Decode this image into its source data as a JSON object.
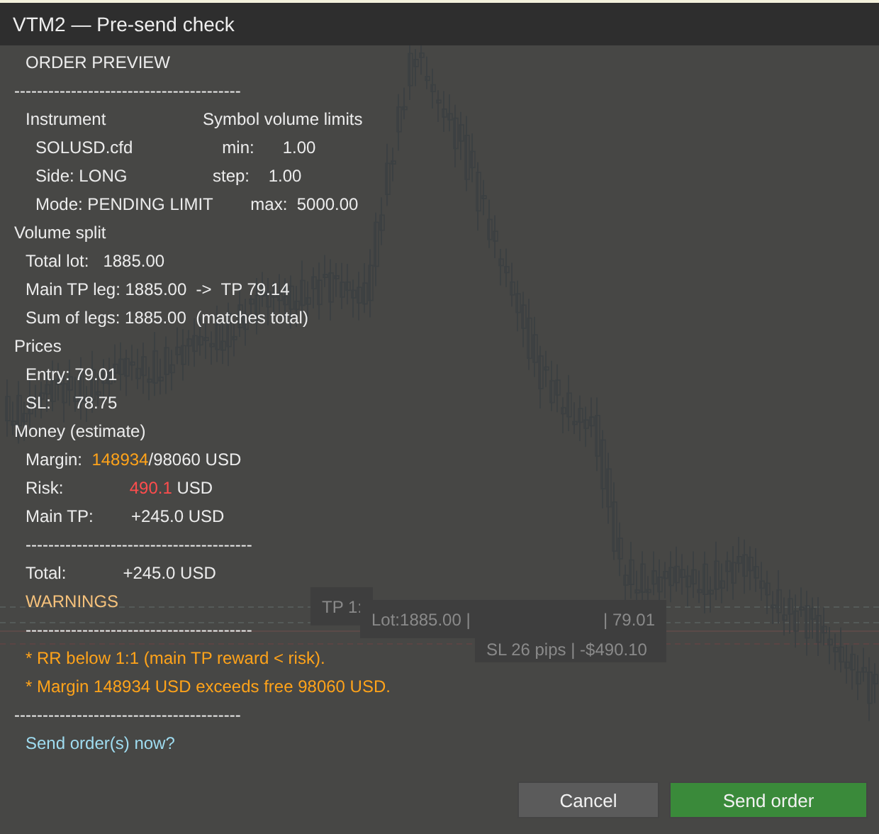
{
  "window": {
    "title": "VTM2 — Pre-send check"
  },
  "chart_tags": [
    {
      "texts": [
        "TP 1:"
      ]
    },
    {
      "texts": [
        "Lot:1885.00 |",
        "| 79.01"
      ]
    },
    {
      "texts": [
        "SL 26 pips | -$490.10"
      ]
    }
  ],
  "lines": [
    {
      "kind": "heading",
      "text": "ORDER PREVIEW"
    },
    {
      "kind": "rule",
      "text": "----------------------------------------"
    },
    {
      "kind": "pair-item",
      "left": "Instrument",
      "right": "Symbol volume limits"
    },
    {
      "kind": "pair-subitem",
      "left": "SOLUSD.cfd",
      "right": "  min:      1.00"
    },
    {
      "kind": "pair-subitem",
      "left": "Side: LONG",
      "right": "step:    1.00"
    },
    {
      "kind": "pair-subitem",
      "left": "Mode: PENDING LIMIT",
      "right": "        max:  5000.00"
    },
    {
      "kind": "section",
      "text": "Volume split"
    },
    {
      "kind": "item",
      "text": "Total lot:   1885.00"
    },
    {
      "kind": "item",
      "text": "Main TP leg: 1885.00  ->  TP 79.14"
    },
    {
      "kind": "item",
      "text": "Sum of legs: 1885.00  (matches total)"
    },
    {
      "kind": "section",
      "text": "Prices"
    },
    {
      "kind": "item",
      "text": "Entry: 79.01"
    },
    {
      "kind": "item",
      "text": "SL:     78.75"
    },
    {
      "kind": "section",
      "text": "Money (estimate)"
    },
    {
      "kind": "item",
      "parts": [
        {
          "text": "Margin:  "
        },
        {
          "text": "148934",
          "color": "#ffa31a"
        },
        {
          "text": "/98060 USD"
        }
      ]
    },
    {
      "kind": "item",
      "parts": [
        {
          "text": "Risk:              "
        },
        {
          "text": "490.1",
          "color": "#ff4d4d"
        },
        {
          "text": " USD"
        }
      ]
    },
    {
      "kind": "item",
      "text": "Main TP:        +245.0 USD"
    },
    {
      "kind": "subrule",
      "text": "----------------------------------------"
    },
    {
      "kind": "item",
      "text": "Total:            +245.0 USD"
    },
    {
      "kind": "warning-heading",
      "text": "WARNINGS"
    },
    {
      "kind": "subrule",
      "text": "----------------------------------------"
    },
    {
      "kind": "warning",
      "text": "* RR below 1:1 (main TP reward < risk)."
    },
    {
      "kind": "warning",
      "text": "* Margin 148934 USD exceeds free 98060 USD."
    },
    {
      "kind": "rule",
      "text": "----------------------------------------"
    },
    {
      "kind": "prompt",
      "text": "Send order(s) now?"
    }
  ],
  "buttons": [
    {
      "label": "Cancel",
      "kind": "secondary"
    },
    {
      "label": "Send order",
      "kind": "primary"
    }
  ]
}
